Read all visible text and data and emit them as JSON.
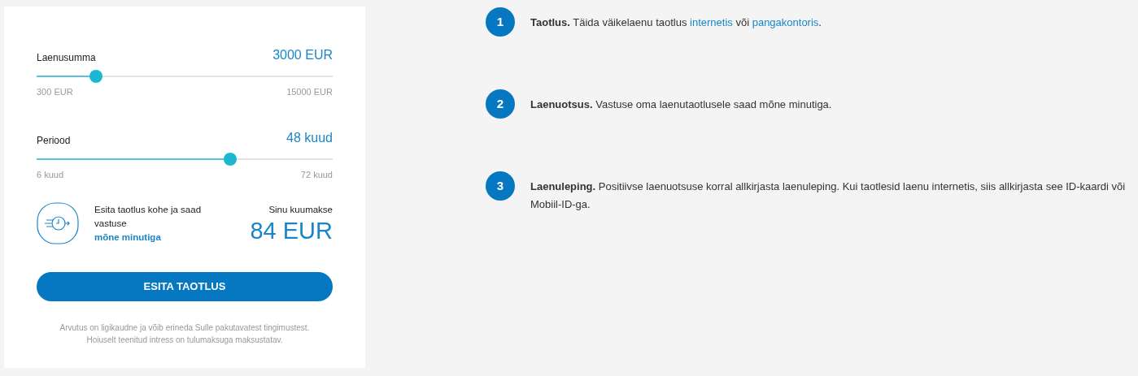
{
  "calculator": {
    "sliders": [
      {
        "label": "Laenusumma",
        "value": "3000 EUR",
        "level": 0.2,
        "min": "300 EUR",
        "max": "15000 EUR"
      },
      {
        "label": "Periood",
        "value": "48 kuud",
        "level": 0.654,
        "min": "6 kuud",
        "max": "72 kuud"
      }
    ],
    "info": {
      "text": "Esita taotlus kohe ja saad vastuse",
      "link": "mõne minutiga"
    },
    "payment": {
      "label": "Sinu kuumakse",
      "value": "84 EUR"
    },
    "button": "ESITA TAOTLUS",
    "disclaimer": [
      "Arvutus on ligikaudne ja võib erineda Sulle pakutavatest tingimustest.",
      "Hoiuselt teenitud intress on tulumaksuga maksustatav."
    ]
  },
  "steps": [
    {
      "number": "1",
      "title": "Taotlus.",
      "segments": [
        {
          "kind": "text",
          "text": " Täida väikelaenu taotlus "
        },
        {
          "kind": "link",
          "text": "internetis"
        },
        {
          "kind": "text",
          "text": " või "
        },
        {
          "kind": "link",
          "text": "pangakontoris"
        },
        {
          "kind": "text",
          "text": "."
        }
      ]
    },
    {
      "number": "2",
      "title": "Laenuotsus.",
      "segments": [
        {
          "kind": "text",
          "text": " Vastuse oma laenutaotlusele saad mõne minutiga."
        }
      ]
    },
    {
      "number": "3",
      "title": "Laenuleping.",
      "segments": [
        {
          "kind": "text",
          "text": " Positiivse laenuotsuse korral allkirjasta laenuleping. Kui taotlesid laenu internetis, siis allkirjasta see ID-kaardi või Mobiil-ID-ga."
        }
      ]
    }
  ]
}
